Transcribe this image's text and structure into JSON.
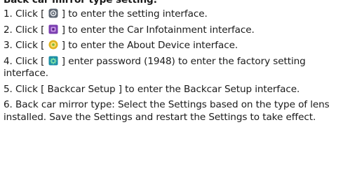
{
  "heading": "Back car mirror type setting:",
  "steps": [
    {
      "prefix": "1. Click [",
      "icon": "settings-app-icon",
      "suffix": "] to enter the setting interface."
    },
    {
      "prefix": "2. Click [",
      "icon": "car-infotainment-icon",
      "suffix": "] to enter the Car Infotainment interface."
    },
    {
      "prefix": "3. Click [",
      "icon": "about-device-icon",
      "suffix": "] to enter the About Device interface."
    },
    {
      "prefix": "4. Click [",
      "icon": "factory-settings-icon",
      "suffix": "] enter password (1948) to enter the factory setting interface."
    },
    {
      "text": "5. Click [ Backcar Setup ] to enter the Backcar Setup interface."
    },
    {
      "text": "6. Back car mirror type: Select the Settings based on the type of lens installed. Save the Settings and restart the Settings to take effect."
    }
  ],
  "colors": {
    "text": "#1a1a1a",
    "settings_icon": "#5b6470",
    "car_infotainment_icon": "#7b3fb0",
    "about_device_icon": "#e0b21c",
    "factory_icon": "#1d8fa6"
  }
}
